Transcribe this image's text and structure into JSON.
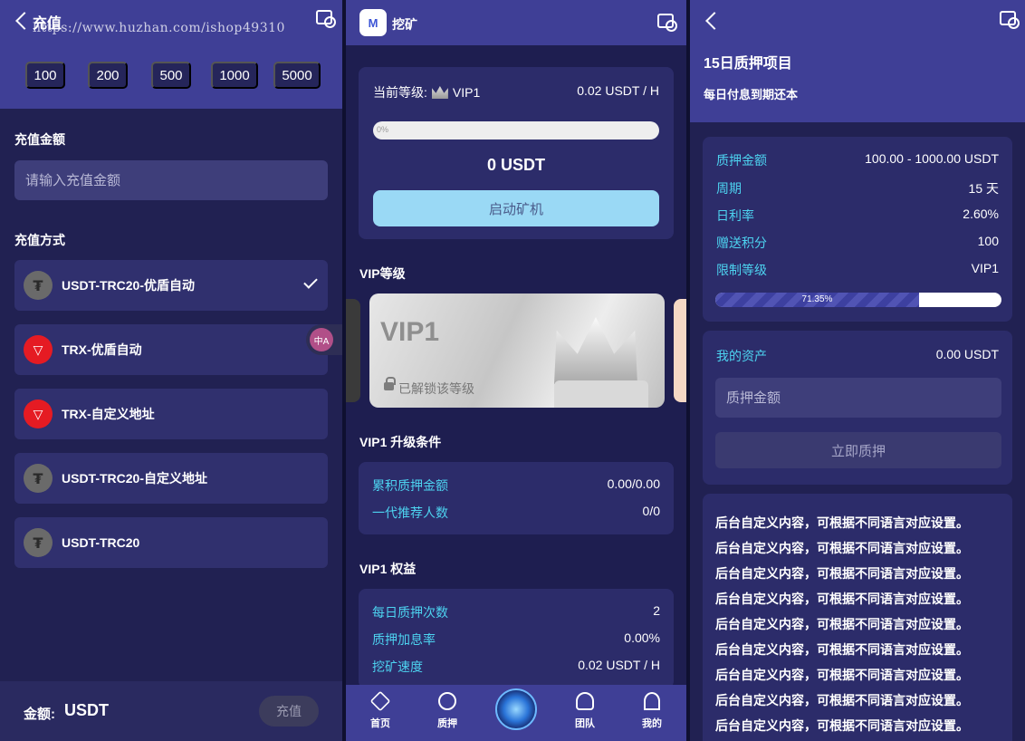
{
  "recharge": {
    "title": "充值",
    "watermark": "https://www.huzhan.com/ishop49310",
    "amount_chips": [
      "100",
      "200",
      "500",
      "1000",
      "5000"
    ],
    "amount_label": "充值金额",
    "amount_placeholder": "请输入充值金额",
    "method_label": "充值方式",
    "methods": [
      {
        "label": "USDT-TRC20-优盾自动",
        "icon": "tether-icon",
        "selected": true
      },
      {
        "label": "TRX-优盾自动",
        "icon": "tron-icon",
        "selected": false
      },
      {
        "label": "TRX-自定义地址",
        "icon": "tron-icon",
        "selected": false
      },
      {
        "label": "USDT-TRC20-自定义地址",
        "icon": "tether-icon",
        "selected": false
      },
      {
        "label": "USDT-TRC20",
        "icon": "tether-icon",
        "selected": false
      }
    ],
    "translate_glyph": "中A",
    "footer_label": "金额:",
    "footer_unit": "USDT",
    "submit_label": "充值"
  },
  "mining": {
    "title": "挖矿",
    "logo_text": "M",
    "level_label": "当前等级:",
    "level_value": "VIP1",
    "rate": "0.02 USDT / H",
    "progress_text": "0%",
    "progress_fraction": 0,
    "mined_amount": "0 USDT",
    "start_label": "启动矿机",
    "vip_section": "VIP等级",
    "vip_card_name": "VIP1",
    "vip_card_status": "已解锁该等级",
    "conditions_title": "VIP1 升级条件",
    "conditions": [
      {
        "k": "累积质押金额",
        "v": "0.00/0.00"
      },
      {
        "k": "一代推荐人数",
        "v": "0/0"
      }
    ],
    "benefits_title": "VIP1 权益",
    "benefits": [
      {
        "k": "每日质押次数",
        "v": "2"
      },
      {
        "k": "质押加息率",
        "v": "0.00%"
      },
      {
        "k": "挖矿速度",
        "v": "0.02 USDT / H"
      }
    ],
    "nav": [
      {
        "label": "首页",
        "icon": "home-icon"
      },
      {
        "label": "质押",
        "icon": "stake-icon"
      },
      {
        "label": "团队",
        "icon": "team-icon"
      },
      {
        "label": "我的",
        "icon": "user-icon"
      }
    ],
    "accent": "#9ad9f5"
  },
  "stake": {
    "title": "15日质押项目",
    "subtitle": "每日付息到期还本",
    "details": [
      {
        "k": "质押金额",
        "v": "100.00 - 1000.00 USDT"
      },
      {
        "k": "周期",
        "v": "15 天"
      },
      {
        "k": "日利率",
        "v": "2.60%"
      },
      {
        "k": "赠送积分",
        "v": "100"
      },
      {
        "k": "限制等级",
        "v": "VIP1"
      }
    ],
    "progress_text": "71.35%",
    "progress_fraction": 0.7135,
    "assets_label": "我的资产",
    "assets_value": "0.00 USDT",
    "amount_placeholder": "质押金额",
    "submit_label": "立即质押",
    "notice_lines": [
      "后台自定义内容，可根据不同语言对应设置。",
      "后台自定义内容，可根据不同语言对应设置。",
      "后台自定义内容，可根据不同语言对应设置。",
      "后台自定义内容，可根据不同语言对应设置。",
      "后台自定义内容，可根据不同语言对应设置。",
      "后台自定义内容，可根据不同语言对应设置。",
      "后台自定义内容，可根据不同语言对应设置。",
      "后台自定义内容，可根据不同语言对应设置。",
      "后台自定义内容，可根据不同语言对应设置。"
    ],
    "key_color": "#4dd3f0"
  }
}
